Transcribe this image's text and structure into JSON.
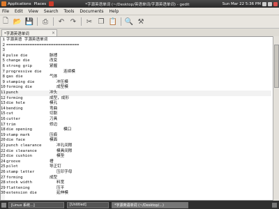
{
  "taskbar_top": {
    "applications": "Applications",
    "places": "Places",
    "system": "System",
    "window_title": "*字源英语单词 (~/Desktop/英语单词/字源英语单词) - gedit",
    "clock": "Sun Mar 22 5:36 PM"
  },
  "menu": [
    "File",
    "Edit",
    "View",
    "Search",
    "Tools",
    "Documents",
    "Help"
  ],
  "toolbar_icons": [
    "new-icon",
    "open-icon",
    "save-icon",
    "print-icon",
    "undo-icon",
    "redo-icon",
    "cut-icon",
    "copy-icon",
    "paste-icon",
    "find-icon",
    "replace-icon"
  ],
  "tab": {
    "label": "*字源英语单词"
  },
  "lines": [
    {
      "n": "1",
      "text": "字源英语 字源英语单词",
      "zh": ""
    },
    {
      "n": "2",
      "text": "===============================",
      "zh": ""
    },
    {
      "n": "3",
      "text": "",
      "zh": ""
    },
    {
      "n": "4",
      "text": "pulse die",
      "zh": "脉搏"
    },
    {
      "n": "5",
      "text": "change die",
      "zh": "改变"
    },
    {
      "n": "6",
      "text": "strong grip",
      "zh": "紧握"
    },
    {
      "n": "7",
      "text": "progressive die",
      "zh": "连续模"
    },
    {
      "n": "8",
      "text": "gas die",
      "zh": "气体"
    },
    {
      "n": "9",
      "text": "stamping die",
      "zh": "冲压模"
    },
    {
      "n": "10",
      "text": "forming die",
      "zh": "成型模"
    },
    {
      "n": "11",
      "text": "punch",
      "zh": "冲头"
    },
    {
      "n": "12",
      "text": "forming",
      "zh": "成型，成形"
    },
    {
      "n": "13",
      "text": "die hole",
      "zh": "模孔"
    },
    {
      "n": "14",
      "text": "bending",
      "zh": "弯曲"
    },
    {
      "n": "15",
      "text": "cut",
      "zh": "切割"
    },
    {
      "n": "16",
      "text": "cutter",
      "zh": "刀具"
    },
    {
      "n": "17",
      "text": "trim",
      "zh": "修边"
    },
    {
      "n": "18",
      "text": "die opening",
      "zh": "模口"
    },
    {
      "n": "19",
      "text": "stamp mark",
      "zh": "压痕"
    },
    {
      "n": "20",
      "text": "die face",
      "zh": "模面"
    },
    {
      "n": "21",
      "text": "punch clearance",
      "zh": "冲孔间隙"
    },
    {
      "n": "22",
      "text": "die clearance",
      "zh": "模具间隙"
    },
    {
      "n": "23",
      "text": "die cushion",
      "zh": "模垫"
    },
    {
      "n": "24",
      "text": "groove",
      "zh": "槽"
    },
    {
      "n": "25",
      "text": "pilot",
      "zh": "导正钉"
    },
    {
      "n": "26",
      "text": "stamp letter",
      "zh": "压印字母"
    },
    {
      "n": "27",
      "text": "forming",
      "zh": "成型"
    },
    {
      "n": "28",
      "text": "stock width",
      "zh": "料宽"
    },
    {
      "n": "29",
      "text": "flattening",
      "zh": "压平"
    },
    {
      "n": "30",
      "text": "extension die",
      "zh": "延伸模"
    }
  ],
  "taskbar_bottom": {
    "items": [
      "[Linux 系统...]",
      "[Untitled]",
      "*字源英语单词 (~/Desktop/...)"
    ],
    "active_index": 2
  }
}
